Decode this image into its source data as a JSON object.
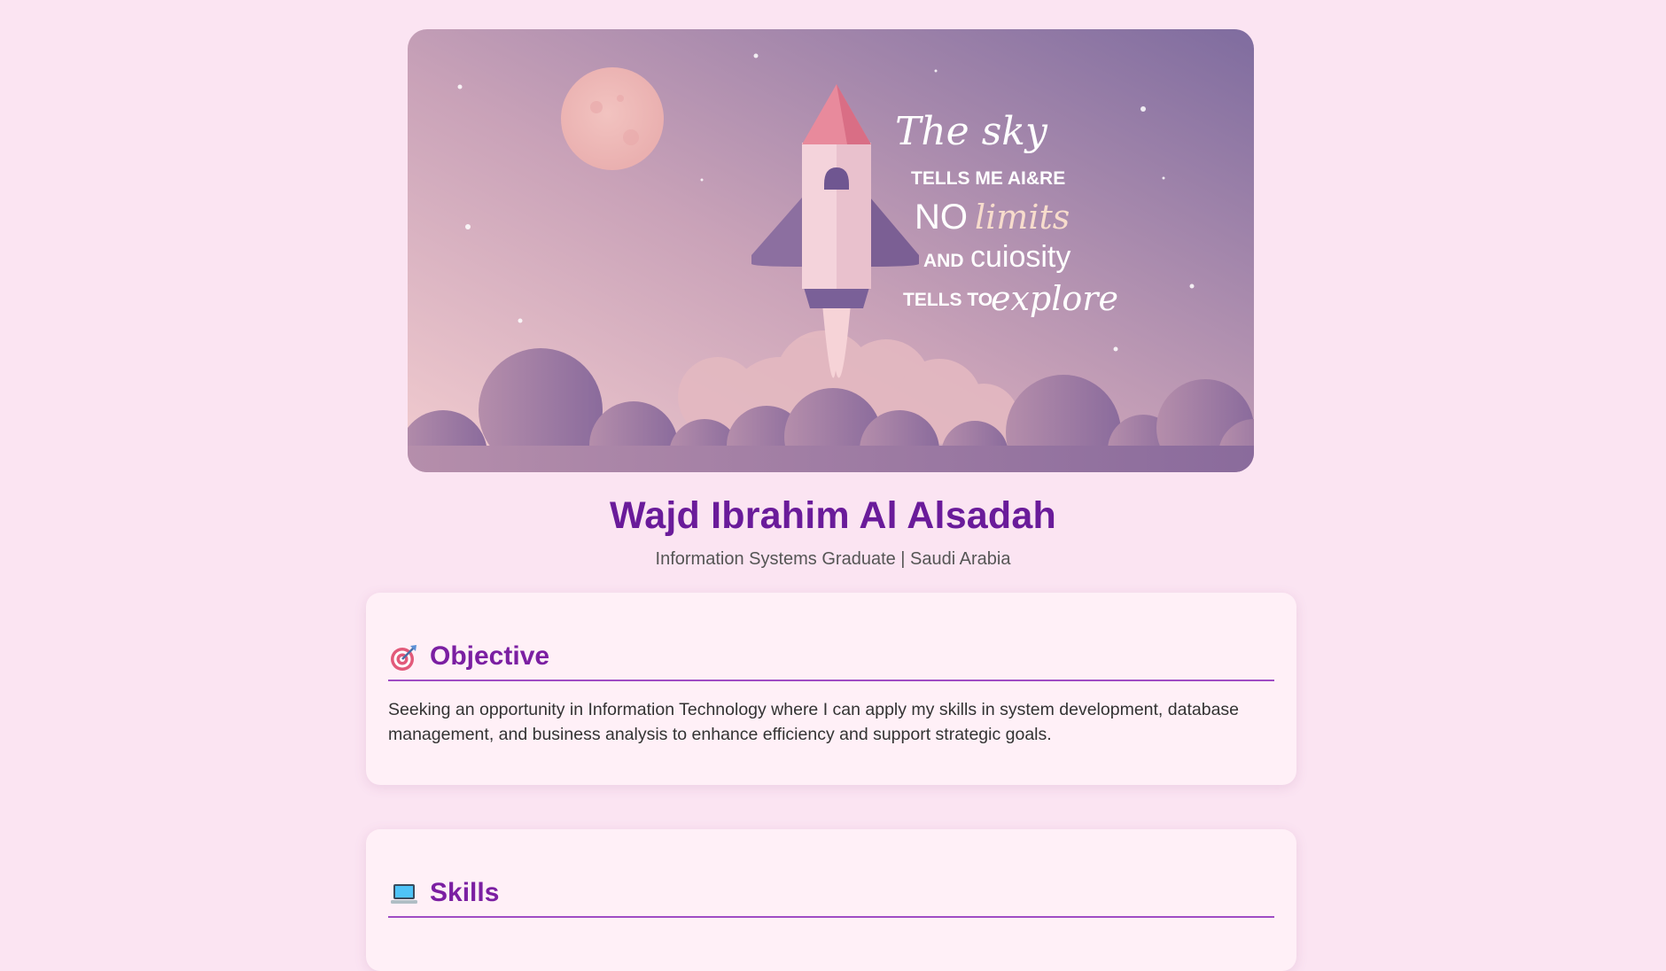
{
  "banner": {
    "line1": "The sky",
    "line2": "TELLS ME AI&RE",
    "line3_a": "NO",
    "line3_b": "limits",
    "line4_a": "AND",
    "line4_b": "cuiosity",
    "line5_a": "TELLS TO",
    "line5_b": "explore"
  },
  "profile": {
    "name": "Wajd Ibrahim Al Alsadah",
    "subtitle": "Information Systems Graduate | Saudi Arabia"
  },
  "sections": {
    "objective": {
      "icon": "target-icon",
      "title": "Objective",
      "body": "Seeking an opportunity in Information Technology where I can apply my skills in system development, database management, and business analysis to enhance efficiency and support strategic goals."
    },
    "skills": {
      "icon": "laptop-icon",
      "title": "Skills"
    }
  },
  "colors": {
    "page_background": "#fbe4f2",
    "name": "#6a1b9a",
    "section_title": "#7b1fa2",
    "section_rule": "#a04cc4",
    "card_background": "#fff0f7"
  }
}
